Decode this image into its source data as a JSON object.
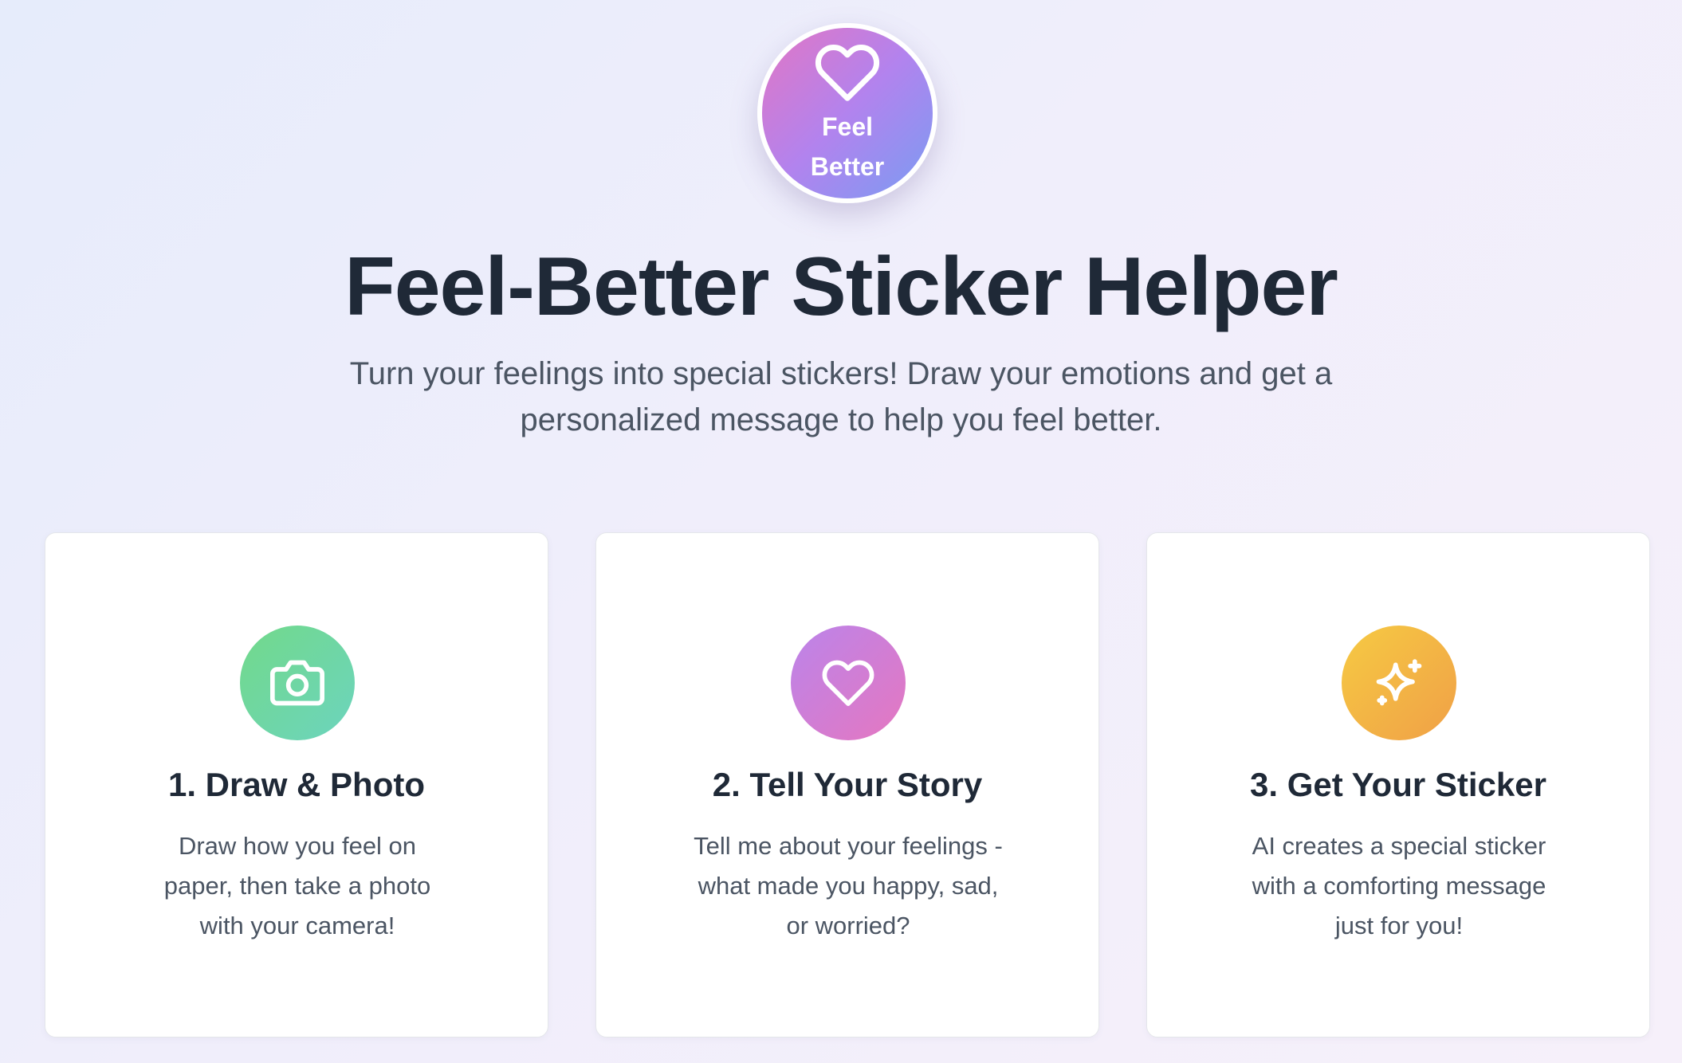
{
  "logo": {
    "line1": "Feel",
    "line2": "Better",
    "icon": "heart-icon"
  },
  "header": {
    "title": "Feel-Better Sticker Helper",
    "subtitle": "Turn your feelings into special stickers! Draw your emotions and get a personalized message to help you feel better."
  },
  "steps": [
    {
      "icon": "camera-icon",
      "title": "1. Draw & Photo",
      "description": "Draw how you feel on paper, then take a photo with your camera!",
      "color_from": "#72d98a",
      "color_to": "#6cd4be"
    },
    {
      "icon": "heart-icon",
      "title": "2. Tell Your Story",
      "description": "Tell me about your feelings - what made you happy, sad, or worried?",
      "color_from": "#bb84ea",
      "color_to": "#e577c0"
    },
    {
      "icon": "sparkles-icon",
      "title": "3. Get Your Sticker",
      "description": "AI creates a special sticker with a comforting message just for you!",
      "color_from": "#f6ca43",
      "color_to": "#f0a047"
    }
  ]
}
